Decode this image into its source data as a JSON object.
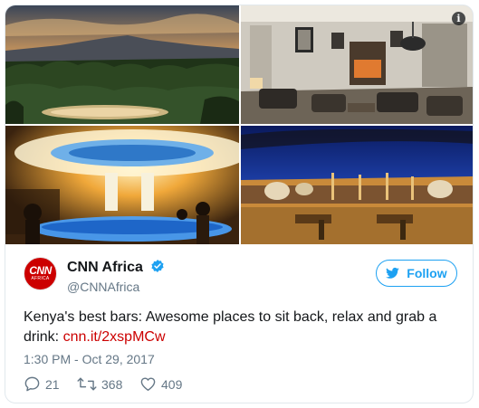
{
  "media": {
    "info_icon_label": "i",
    "images": [
      {
        "name": "mountain-landscape-photo"
      },
      {
        "name": "lounge-interior-photo"
      },
      {
        "name": "illuminated-bar-photo"
      },
      {
        "name": "rooftop-terrace-photo"
      }
    ]
  },
  "author": {
    "avatar_text": "CNN",
    "avatar_subtext": "AFRICA",
    "display_name": "CNN Africa",
    "handle": "@CNNAfrica",
    "follow_label": "Follow"
  },
  "tweet": {
    "text": "Kenya's best bars: Awesome places to sit back, relax and grab a drink: ",
    "link_text": "cnn.it/2xspMCw",
    "timestamp": "1:30 PM - Oct 29, 2017"
  },
  "actions": {
    "reply_count": "21",
    "retweet_count": "368",
    "like_count": "409"
  },
  "colors": {
    "brand_blue": "#1da1f2",
    "link_red": "#cc0000",
    "secondary_text": "#657786",
    "primary_text": "#14171a",
    "avatar_red": "#cc0000"
  }
}
